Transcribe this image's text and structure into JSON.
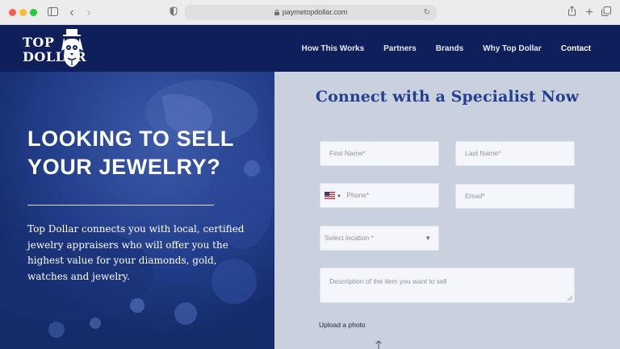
{
  "browser": {
    "url": "paymetopdollar.com",
    "icons": [
      "sidebar-icon",
      "chevron-left-icon",
      "chevron-right-icon",
      "shield-icon",
      "lock-icon",
      "reload-icon",
      "share-icon",
      "plus-icon",
      "tabs-icon"
    ]
  },
  "header": {
    "logo_top": "TOP",
    "logo_dollar": "DOLLAR",
    "nav": {
      "how": "How This Works",
      "partners": "Partners",
      "brands": "Brands",
      "why": "Why Top Dollar",
      "contact": "Contact"
    },
    "colors": {
      "background": "#0f1f5c",
      "text": "#ffffff"
    }
  },
  "hero": {
    "title_line1": "LOOKING TO SELL",
    "title_line2": "YOUR JEWELRY?",
    "description": "Top Dollar connects you with local, certified jewelry appraisers who will offer you the highest value for your diamonds, gold, watches and jewelry."
  },
  "form": {
    "title": "Connect with a Specialist Now",
    "first_name_placeholder": "First Name*",
    "last_name_placeholder": "Last Name*",
    "phone_placeholder": "Phone*",
    "email_placeholder": "Email*",
    "location_placeholder": "Select location *",
    "description_placeholder": "Description of the item you want to sell",
    "upload_label": "Upload a photo",
    "colors": {
      "title": "#243f91",
      "panel": "#c9d0de"
    }
  }
}
